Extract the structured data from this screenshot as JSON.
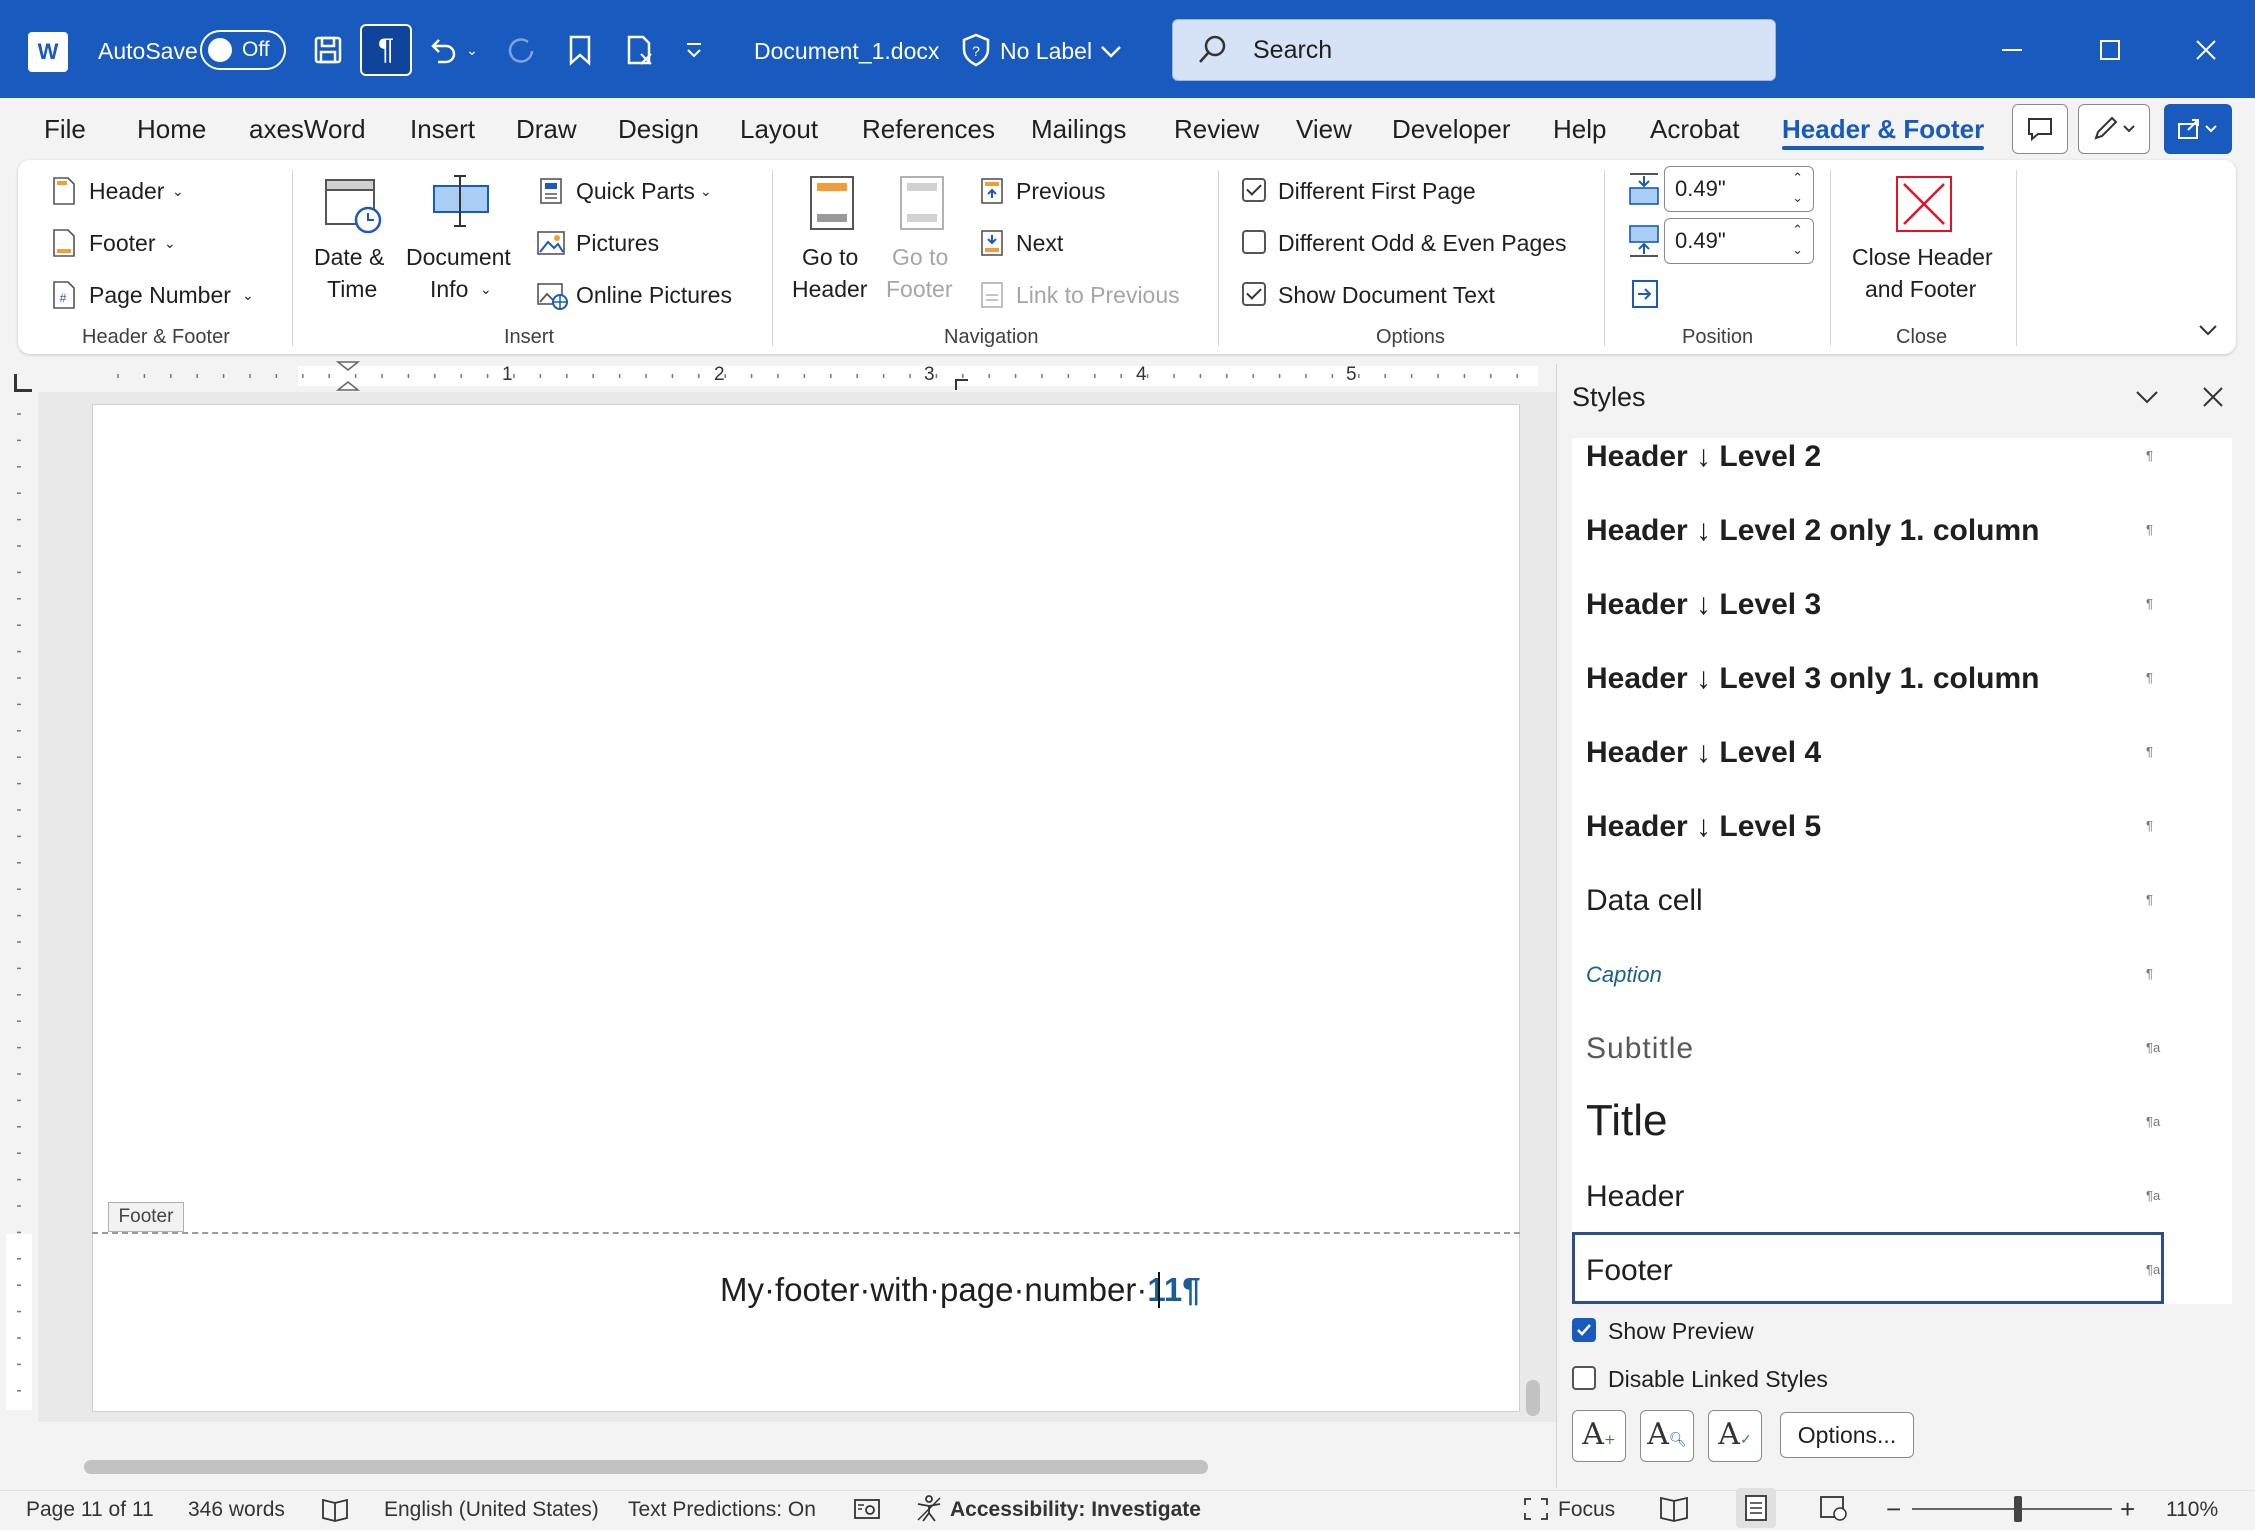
{
  "titlebar": {
    "autosave_label": "AutoSave",
    "autosave_state": "Off",
    "filename": "Document_1.docx",
    "label_status": "No Label",
    "search_placeholder": "Search"
  },
  "menu": {
    "tabs": [
      "File",
      "Home",
      "axesWord",
      "Insert",
      "Draw",
      "Design",
      "Layout",
      "References",
      "Mailings",
      "Review",
      "View",
      "Developer",
      "Help",
      "Acrobat",
      "Header & Footer"
    ],
    "active": "Header & Footer"
  },
  "ribbon": {
    "header_footer_group": {
      "header": "Header",
      "footer": "Footer",
      "page_number": "Page Number",
      "label": "Header & Footer"
    },
    "insert_group": {
      "date_time_1": "Date &",
      "date_time_2": "Time",
      "doc_info_1": "Document",
      "doc_info_2": "Info",
      "quick_parts": "Quick Parts",
      "pictures": "Pictures",
      "online_pictures": "Online Pictures",
      "label": "Insert"
    },
    "navigation_group": {
      "go_header_1": "Go to",
      "go_header_2": "Header",
      "go_footer_1": "Go to",
      "go_footer_2": "Footer",
      "previous": "Previous",
      "next": "Next",
      "link_previous": "Link to Previous",
      "label": "Navigation"
    },
    "options_group": {
      "diff_first": "Different First Page",
      "diff_odd_even": "Different Odd & Even Pages",
      "show_doc_text": "Show Document Text",
      "label": "Options",
      "diff_first_checked": true,
      "diff_odd_even_checked": false,
      "show_doc_text_checked": true
    },
    "position_group": {
      "header_pos": "0.49\"",
      "footer_pos": "0.49\"",
      "label": "Position"
    },
    "close_group": {
      "close_1": "Close Header",
      "close_2": "and Footer",
      "label": "Close"
    }
  },
  "ruler": {
    "numbers": [
      "1",
      "2",
      "3",
      "4",
      "5"
    ]
  },
  "document": {
    "footer_tag": "Footer",
    "footer_text": "My·footer·with·page·number·",
    "page_number": "11",
    "pilcrow": "¶"
  },
  "styles_pane": {
    "title": "Styles",
    "items": [
      {
        "name": "Header ↓ Level 2",
        "mark": "¶"
      },
      {
        "name": "Header ↓ Level 2 only 1. column",
        "mark": "¶"
      },
      {
        "name": "Header ↓ Level 3",
        "mark": "¶"
      },
      {
        "name": "Header ↓ Level 3 only 1. column",
        "mark": "¶"
      },
      {
        "name": "Header ↓ Level 4",
        "mark": "¶"
      },
      {
        "name": "Header ↓ Level 5",
        "mark": "¶"
      },
      {
        "name": "Data cell",
        "mark": "¶"
      },
      {
        "name": "Caption",
        "mark": "¶"
      },
      {
        "name": "Subtitle",
        "mark": "¶a"
      },
      {
        "name": "Title",
        "mark": "¶a"
      },
      {
        "name": "Header",
        "mark": "¶a"
      },
      {
        "name": "Footer",
        "mark": "¶a"
      }
    ],
    "selected": "Footer",
    "show_preview": "Show Preview",
    "show_preview_checked": true,
    "disable_linked": "Disable Linked Styles",
    "disable_linked_checked": false,
    "options_button": "Options..."
  },
  "statusbar": {
    "page": "Page 11 of 11",
    "words": "346 words",
    "language": "English (United States)",
    "predictions": "Text Predictions: On",
    "accessibility": "Accessibility: Investigate",
    "focus": "Focus",
    "zoom": "110%"
  },
  "colors": {
    "accent": "#185abd",
    "titlebar": "#185abd",
    "close_red": "#e81123",
    "page_number": "#1a5e93"
  }
}
